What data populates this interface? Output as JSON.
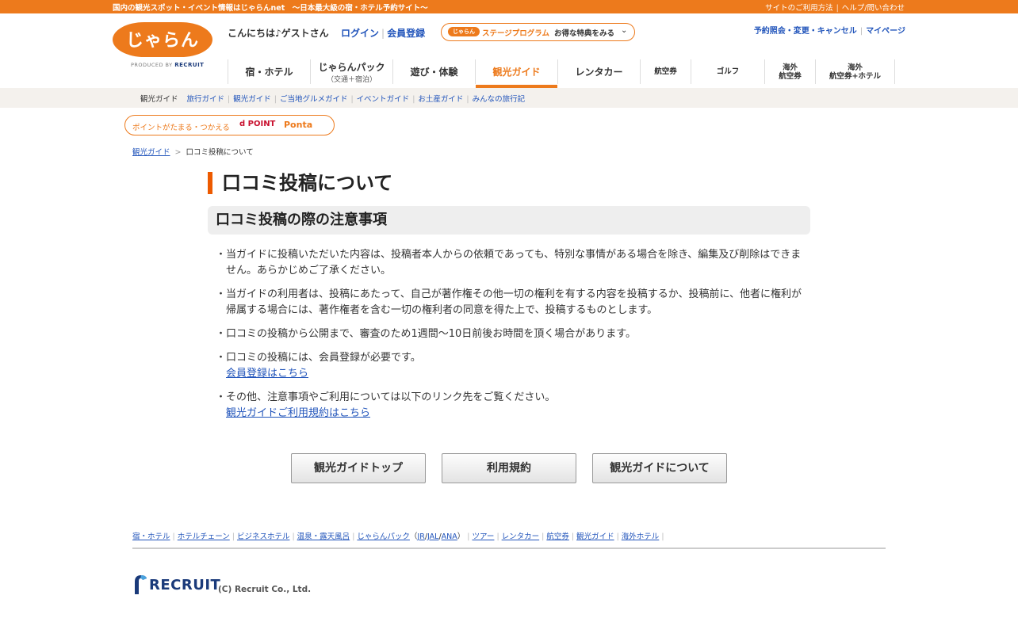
{
  "topbar": {
    "tagline": "国内の観光スポット・イベント情報はじゃらんnet　～日本最大級の宿・ホテル予約サイト～",
    "links": [
      "サイトのご利用方法",
      "ヘルプ/問い合わせ"
    ]
  },
  "header": {
    "logo_text": "じゃらん",
    "produced_by": "PRODUCED BY",
    "produced_brand": "RECRUIT",
    "greeting": "こんにちは♪ゲストさん",
    "login": "ログイン",
    "register": "会員登録",
    "stage_pill": "じゃらん",
    "stage_label": "ステージプログラム",
    "stage_cta": "お得な特典をみる",
    "right_links": [
      "予約照会・変更・キャンセル",
      "マイページ"
    ]
  },
  "mainnav": [
    {
      "label": "宿・ホテル",
      "sub": ""
    },
    {
      "label": "じゃらんパック",
      "sub": "（交通＋宿泊）"
    },
    {
      "label": "遊び・体験",
      "sub": ""
    },
    {
      "label": "観光ガイド",
      "sub": "",
      "active": true
    },
    {
      "label": "レンタカー",
      "sub": ""
    },
    {
      "label": "航空券",
      "sub": ""
    },
    {
      "label": "ゴルフ",
      "sub": ""
    },
    {
      "label": "海外\n航空券",
      "sub": ""
    },
    {
      "label": "海外\n航空券+ホテル",
      "sub": ""
    }
  ],
  "subnav": {
    "current": "観光ガイド",
    "links": [
      "旅行ガイド",
      "観光ガイド",
      "ご当地グルメガイド",
      "イベントガイド",
      "お土産ガイド",
      "みんなの旅行記"
    ]
  },
  "points": {
    "label": "ポイントがたまる・つかえる",
    "dpoint": "d POINT",
    "ponta": "Ponta"
  },
  "breadcrumb": {
    "home": "観光ガイド",
    "sep": ">",
    "current": "口コミ投稿について"
  },
  "page": {
    "title": "口コミ投稿について",
    "section_title": "口コミ投稿の際の注意事項",
    "notes": [
      {
        "text": "当ガイドに投稿いただいた内容は、投稿者本人からの依頼であっても、特別な事情がある場合を除き、編集及び削除はできません。あらかじめご了承ください。",
        "link": ""
      },
      {
        "text": "当ガイドの利用者は、投稿にあたって、自己が著作権その他一切の権利を有する内容を投稿するか、投稿前に、他者に権利が帰属する場合には、著作権者を含む一切の権利者の同意を得た上で、投稿するものとします。",
        "link": ""
      },
      {
        "text": "口コミの投稿から公開まで、審査のため1週間～10日前後お時間を頂く場合があります。",
        "link": ""
      },
      {
        "text": "口コミの投稿には、会員登録が必要です。",
        "link": "会員登録はこちら"
      },
      {
        "text": "その他、注意事項やご利用については以下のリンク先をご覧ください。",
        "link": "観光ガイドご利用規約はこちら"
      }
    ]
  },
  "buttons": [
    "観光ガイドトップ",
    "利用規約",
    "観光ガイドについて"
  ],
  "footer": {
    "links": [
      "宿・ホテル",
      "ホテルチェーン",
      "ビジネスホテル",
      "温泉・露天風呂",
      "じゃらんパック"
    ],
    "pack_sub": [
      "JR",
      "JAL",
      "ANA"
    ],
    "links2": [
      "ツアー",
      "レンタカー",
      "航空券",
      "観光ガイド",
      "海外ホテル"
    ],
    "brand": "RECRUIT",
    "copyright": "(C) Recruit Co., Ltd."
  },
  "colors": {
    "brand_orange": "#ed7a1c",
    "link_blue": "#2255bb"
  }
}
